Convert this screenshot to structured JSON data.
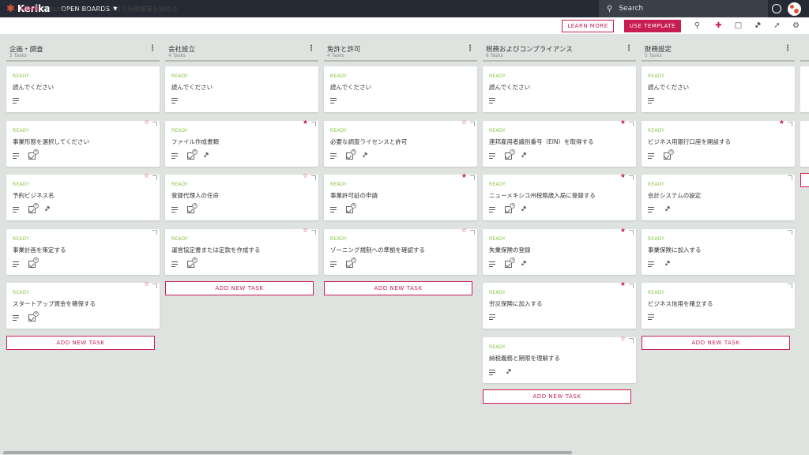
{
  "topbar": {
    "logo": "Kerika",
    "open_boards": "OPEN BOARDS",
    "search_placeholder": "Search"
  },
  "breadcrumb": {
    "home": "HOME",
    "workspace": "Kerika",
    "board": "ニューメキシコで新規事業を始める"
  },
  "actions": {
    "learn_more": "LEARN MORE",
    "use_template": "USE TEMPLATE"
  },
  "add_task_label": "ADD NEW TASK",
  "columns": [
    {
      "title": "企画・調査",
      "count": "5 Tasks",
      "cards": [
        {
          "status": "READY",
          "title": "読んでください",
          "star": "",
          "checklist": "",
          "attach": false
        },
        {
          "status": "READY",
          "title": "事業形態を選択してください",
          "star": "empty",
          "checklist": "4",
          "attach": false
        },
        {
          "status": "READY",
          "title": "予約ビジネス名",
          "star": "empty",
          "checklist": "4",
          "attach": true
        },
        {
          "status": "READY",
          "title": "事業計画を策定する",
          "star": "",
          "checklist": "4",
          "attach": false
        },
        {
          "status": "READY",
          "title": "スタートアップ資金を確保する",
          "star": "empty",
          "checklist": "4",
          "attach": false
        }
      ]
    },
    {
      "title": "会社設立",
      "count": "4 Tasks",
      "cards": [
        {
          "status": "READY",
          "title": "読んでください",
          "star": "",
          "checklist": "",
          "attach": false
        },
        {
          "status": "READY",
          "title": "ファイル作成書類",
          "star": "filled",
          "checklist": "4",
          "attach": true
        },
        {
          "status": "READY",
          "title": "登録代理人の任命",
          "star": "empty",
          "checklist": "3",
          "attach": false
        },
        {
          "status": "READY",
          "title": "運営協定書または定款を作成する",
          "star": "empty",
          "checklist": "4",
          "attach": false
        }
      ]
    },
    {
      "title": "免許と許可",
      "count": "4 Tasks",
      "cards": [
        {
          "status": "READY",
          "title": "読んでください",
          "star": "",
          "checklist": "",
          "attach": false
        },
        {
          "status": "READY",
          "title": "必要な調査ライセンスと許可",
          "star": "empty",
          "checklist": "4",
          "attach": true
        },
        {
          "status": "READY",
          "title": "事業許可証の申請",
          "star": "filled",
          "checklist": "4",
          "attach": false
        },
        {
          "status": "READY",
          "title": "ゾーニング規制への準拠を確認する",
          "star": "empty",
          "checklist": "4",
          "attach": false
        }
      ]
    },
    {
      "title": "税務およびコンプライアンス",
      "count": "6 Tasks",
      "cards": [
        {
          "status": "READY",
          "title": "読んでください",
          "star": "",
          "checklist": "",
          "attach": false
        },
        {
          "status": "READY",
          "title": "連邦雇用者識別番号（EIN）を取得する",
          "star": "filled",
          "checklist": "3",
          "attach": true
        },
        {
          "status": "READY",
          "title": "ニューメキシコ州税務歳入局に登録する",
          "star": "filled",
          "checklist": "3",
          "attach": true
        },
        {
          "status": "READY",
          "title": "失業保険の登録",
          "star": "filled",
          "checklist": "3",
          "attach": true
        },
        {
          "status": "READY",
          "title": "労災保険に加入する",
          "star": "filled",
          "checklist": "",
          "attach": false
        },
        {
          "status": "READY",
          "title": "納税義務と期限を理解する",
          "star": "empty",
          "checklist": "",
          "attach": true
        }
      ]
    },
    {
      "title": "財務設定",
      "count": "5 Tasks",
      "cards": [
        {
          "status": "READY",
          "title": "読んでください",
          "star": "",
          "checklist": "",
          "attach": false
        },
        {
          "status": "READY",
          "title": "ビジネス用銀行口座を開設する",
          "star": "filled",
          "checklist": "4",
          "attach": false
        },
        {
          "status": "READY",
          "title": "会計システムの設定",
          "star": "",
          "checklist": "",
          "attach": true
        },
        {
          "status": "READY",
          "title": "事業保険に加入する",
          "star": "",
          "checklist": "",
          "attach": true
        },
        {
          "status": "READY",
          "title": "ビジネス信用を確立する",
          "star": "",
          "checklist": "",
          "attach": false
        }
      ]
    }
  ],
  "partial_column": {
    "cards": 2
  }
}
